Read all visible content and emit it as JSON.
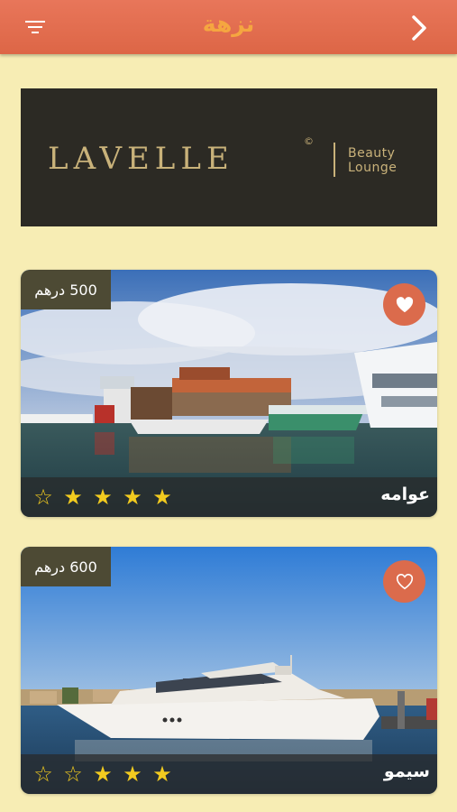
{
  "header": {
    "title": "نزهة",
    "filter_icon": "filter-icon",
    "back_icon": "chevron-right-icon",
    "accent": "#f5a640",
    "bar_color": "#dd6646"
  },
  "banner": {
    "brand": "LAVELLE",
    "copyright": "©",
    "line1": "Beauty",
    "line2": "Lounge"
  },
  "listings": [
    {
      "price": "500 درهم",
      "name": "عوامه",
      "rating": 4,
      "max_rating": 5,
      "favorited": true,
      "fav_icon": "heart-filled-icon"
    },
    {
      "price": "600 درهم",
      "name": "سيمو",
      "rating": 3,
      "max_rating": 5,
      "favorited": false,
      "fav_icon": "heart-outline-icon"
    }
  ]
}
